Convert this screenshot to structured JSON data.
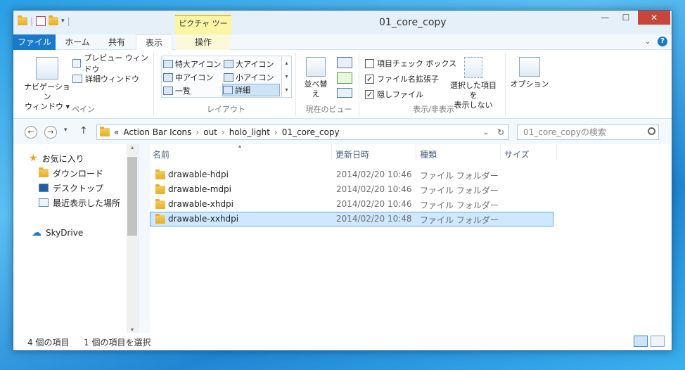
{
  "window": {
    "title": "01_core_copy",
    "contextual_tab_group": "ピクチャ ツール",
    "buttons": {
      "minimize": "—",
      "maximize": "☐",
      "close": "✕"
    }
  },
  "tabs": [
    "ファイル",
    "ホーム",
    "共有",
    "表示",
    "操作"
  ],
  "ribbon": {
    "pane_group": {
      "nav_pane_btn": "ナビゲーション\nウィンドウ ▾",
      "preview_btn": "プレビュー ウィンドウ",
      "details_btn": "詳細ウィンドウ",
      "label": "ペイン"
    },
    "layout_group": {
      "items": [
        "特大アイコン",
        "大アイコン",
        "中アイコン",
        "小アイコン",
        "一覧",
        "詳細"
      ],
      "selected": "詳細",
      "label": "レイアウト"
    },
    "view_group": {
      "sort_btn": "並べ替え",
      "label": "現在のビュー"
    },
    "show_hide_group": {
      "checkbox1": "項目チェック ボックス",
      "checkbox2": "ファイル名拡張子",
      "checkbox3": "隠しファイル",
      "hide_btn": "選択した項目を\n表示しない",
      "label": "表示/非表示"
    },
    "options_btn": "オプション"
  },
  "address": {
    "crumbs": [
      "«",
      "Action Bar Icons",
      "›",
      "out",
      "›",
      "holo_light",
      "›",
      "01_core_copy"
    ],
    "search_placeholder": "01_core_copyの検索"
  },
  "navpane": {
    "favorites": "お気に入り",
    "items": [
      "ダウンロード",
      "デスクトップ",
      "最近表示した場所"
    ],
    "skydrive": "SkyDrive"
  },
  "columns": {
    "name": "名前",
    "date": "更新日時",
    "type": "種類",
    "size": "サイズ"
  },
  "files": [
    {
      "name": "drawable-hdpi",
      "date": "2014/02/20 10:46",
      "type": "ファイル フォルダー"
    },
    {
      "name": "drawable-mdpi",
      "date": "2014/02/20 10:46",
      "type": "ファイル フォルダー"
    },
    {
      "name": "drawable-xhdpi",
      "date": "2014/02/20 10:46",
      "type": "ファイル フォルダー"
    },
    {
      "name": "drawable-xxhdpi",
      "date": "2014/02/20 10:48",
      "type": "ファイル フォルダー"
    }
  ],
  "status": {
    "count": "4 個の項目",
    "selected": "1 個の項目を選択"
  },
  "colors": {
    "accent": "#1979ca",
    "selection": "#cde8ff"
  }
}
